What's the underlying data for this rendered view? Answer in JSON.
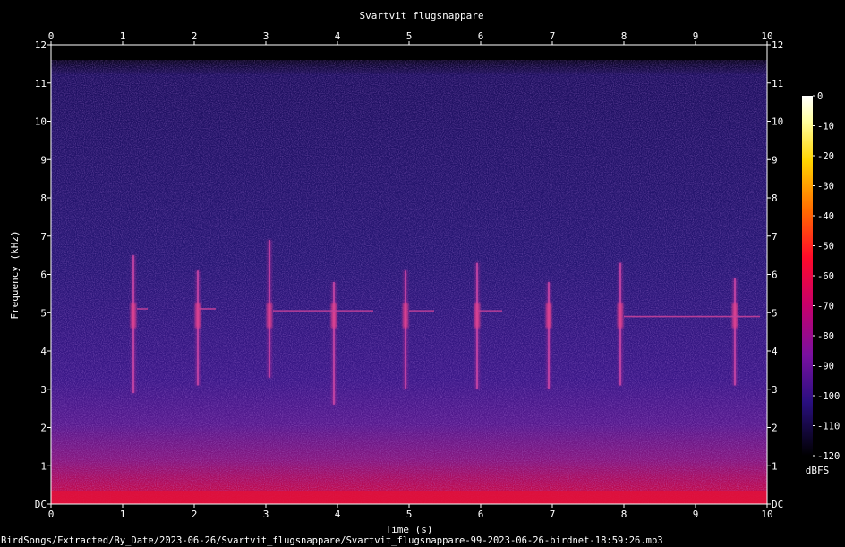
{
  "chart_data": {
    "type": "heatmap",
    "title": "Svartvit flugsnappare",
    "xlabel": "Time (s)",
    "ylabel": "Frequency (kHz)",
    "xlim": [
      0,
      10
    ],
    "ylim": [
      0,
      12
    ],
    "x_ticks": [
      "0",
      "1",
      "2",
      "3",
      "4",
      "5",
      "6",
      "7",
      "8",
      "9",
      "10"
    ],
    "y_ticks": [
      "DC",
      "1",
      "2",
      "3",
      "4",
      "5",
      "6",
      "7",
      "8",
      "9",
      "10",
      "11",
      "12"
    ],
    "colorbar": {
      "label": "dBFS",
      "range": [
        -120,
        0
      ],
      "ticks": [
        "0",
        "-10",
        "-20",
        "-30",
        "-40",
        "-50",
        "-60",
        "-70",
        "-80",
        "-90",
        "-100",
        "-110",
        "-120"
      ]
    },
    "calls": [
      {
        "t": 1.15,
        "f_low": 2.9,
        "f_high": 6.5
      },
      {
        "t": 2.05,
        "f_low": 3.1,
        "f_high": 6.1
      },
      {
        "t": 3.05,
        "f_low": 3.3,
        "f_high": 6.9
      },
      {
        "t": 3.95,
        "f_low": 2.6,
        "f_high": 5.8
      },
      {
        "t": 4.95,
        "f_low": 3.0,
        "f_high": 6.1
      },
      {
        "t": 5.95,
        "f_low": 3.0,
        "f_high": 6.3
      },
      {
        "t": 6.95,
        "f_low": 3.0,
        "f_high": 5.8
      },
      {
        "t": 7.95,
        "f_low": 3.1,
        "f_high": 6.3
      },
      {
        "t": 9.55,
        "f_low": 3.1,
        "f_high": 5.9
      }
    ],
    "tones": [
      {
        "t_start": 1.2,
        "t_end": 1.35,
        "f": 5.1
      },
      {
        "t_start": 2.05,
        "t_end": 2.3,
        "f": 5.1
      },
      {
        "t_start": 3.1,
        "t_end": 4.5,
        "f": 5.05
      },
      {
        "t_start": 5.0,
        "t_end": 5.35,
        "f": 5.05
      },
      {
        "t_start": 5.95,
        "t_end": 6.3,
        "f": 5.05
      },
      {
        "t_start": 8.0,
        "t_end": 9.9,
        "f": 4.9
      }
    ],
    "colors": {
      "background": "#000000",
      "noise_high": "#1c0f5a",
      "noise_low": "#b8004f",
      "call": "#c02d9a",
      "hot": "#ff2030"
    }
  },
  "file_path": "BirdSongs/Extracted/By_Date/2023-06-26/Svartvit_flugsnappare/Svartvit_flugsnappare-99-2023-06-26-birdnet-18:59:26.mp3"
}
